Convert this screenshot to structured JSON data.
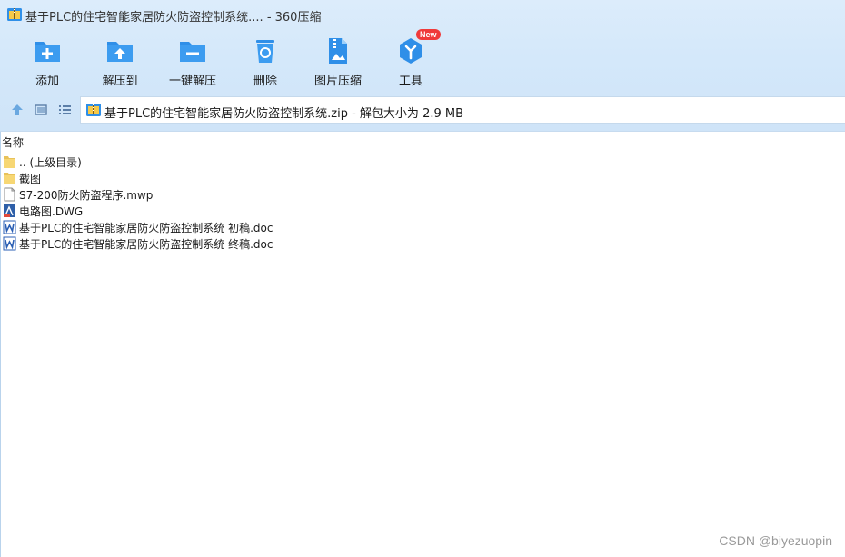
{
  "window": {
    "title": "基于PLC的住宅智能家居防火防盗控制系统.... - 360压缩"
  },
  "toolbar": {
    "items": [
      {
        "label": "添加",
        "icon": "add-folder-icon"
      },
      {
        "label": "解压到",
        "icon": "extract-to-icon"
      },
      {
        "label": "一键解压",
        "icon": "one-click-extract-icon"
      },
      {
        "label": "删除",
        "icon": "recycle-bin-icon"
      },
      {
        "label": "图片压缩",
        "icon": "image-compress-icon"
      },
      {
        "label": "工具",
        "icon": "tools-icon",
        "badge": "New"
      }
    ]
  },
  "nav": {
    "address": "基于PLC的住宅智能家居防火防盗控制系统.zip - 解包大小为 2.9 MB"
  },
  "list": {
    "column_header": "名称",
    "rows": [
      {
        "name": ".. (上级目录)",
        "icon": "folder-icon"
      },
      {
        "name": "截图",
        "icon": "folder-icon"
      },
      {
        "name": "S7-200防火防盗程序.mwp",
        "icon": "file-icon"
      },
      {
        "name": "电路图.DWG",
        "icon": "dwg-file-icon"
      },
      {
        "name": "基于PLC的住宅智能家居防火防盗控制系统 初稿.doc",
        "icon": "word-doc-icon"
      },
      {
        "name": "基于PLC的住宅智能家居防火防盗控制系统 终稿.doc",
        "icon": "word-doc-icon"
      }
    ]
  },
  "watermark": "CSDN @biyezuopin",
  "colors": {
    "accent": "#2f8fe8",
    "chrome_bg": "#d4e8fa",
    "badge": "#f03a3a",
    "folder": "#f7d774"
  }
}
